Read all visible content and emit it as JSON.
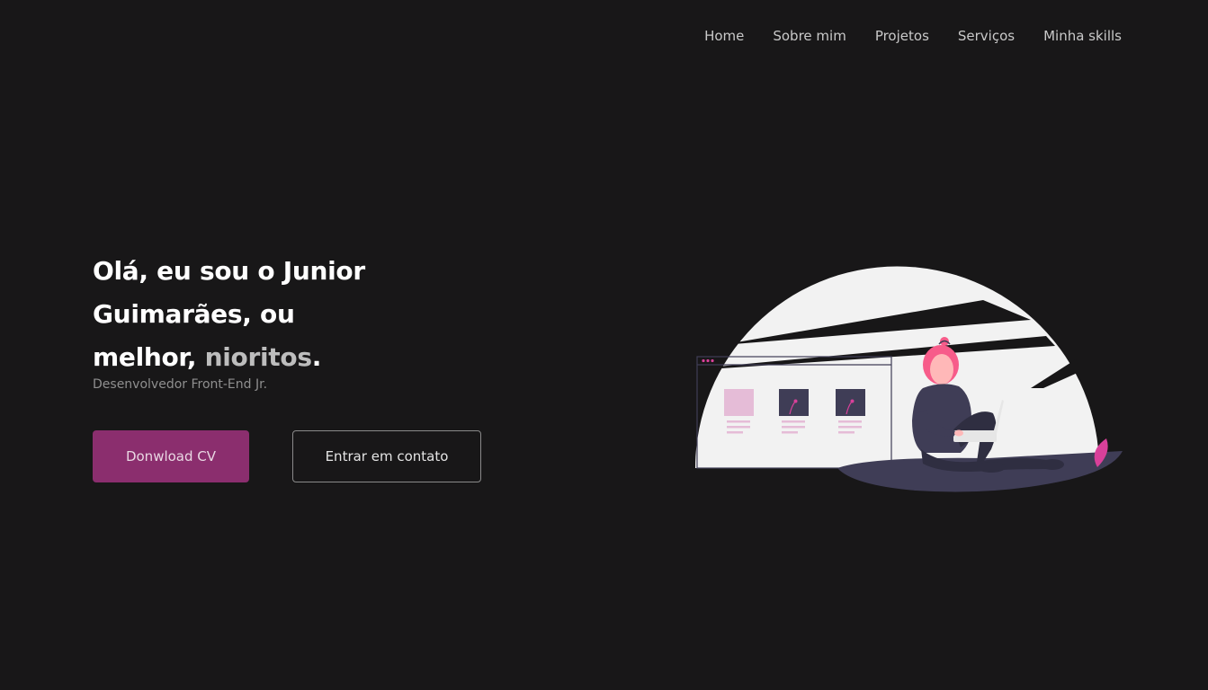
{
  "nav": {
    "items": [
      "Home",
      "Sobre mim",
      "Projetos",
      "Serviços",
      "Minha skills"
    ]
  },
  "hero": {
    "title_line1": "Olá, eu sou o Junior",
    "title_line2": "Guimarães, ou",
    "title_line3_prefix": "melhor, ",
    "title_highlight": "nioritos",
    "title_suffix": ".",
    "subtitle": "Desenvolvedor Front-End Jr."
  },
  "buttons": {
    "download_cv": "Donwload CV",
    "contact": "Entrar em contato"
  },
  "colors": {
    "background": "#181718",
    "accent": "#8b2e6e",
    "highlight_text": "#bdbdbd",
    "illustration_pink": "#f75c8a",
    "illustration_dark": "#3f3d56"
  },
  "illustration": {
    "subject": "woman-sitting-with-laptop"
  }
}
